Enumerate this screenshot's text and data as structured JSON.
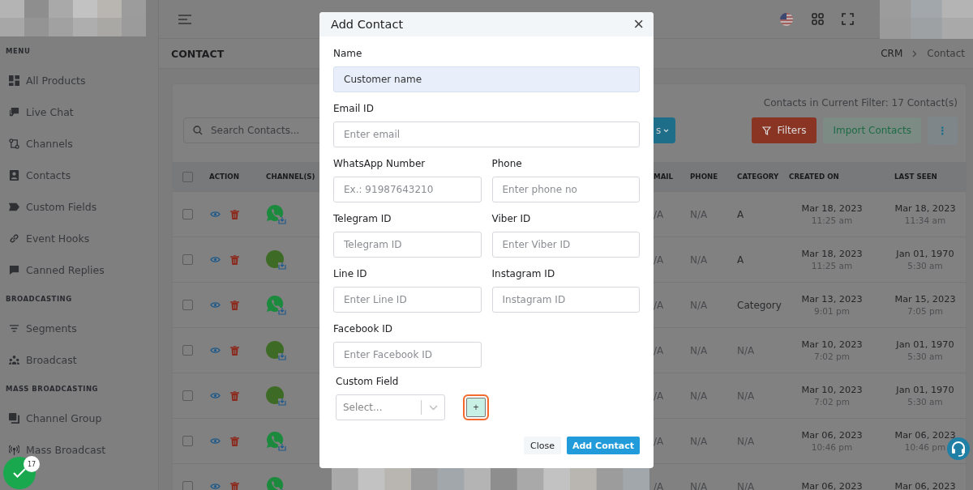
{
  "sidebar": {
    "sections": [
      {
        "title": "MENU",
        "items": [
          {
            "label": "All Products"
          },
          {
            "label": "Live Chat"
          },
          {
            "label": "Channels"
          },
          {
            "label": "Contacts"
          },
          {
            "label": "Custom Fields"
          },
          {
            "label": "Event Hooks"
          },
          {
            "label": "Canned Replies"
          }
        ]
      },
      {
        "title": "BROADCASTING",
        "items": [
          {
            "label": "Segments"
          },
          {
            "label": "Broadcast"
          }
        ]
      },
      {
        "title": "MASS BROADCASTING",
        "items": [
          {
            "label": "Channel Group"
          },
          {
            "label": "Mass Broadcast"
          }
        ]
      }
    ]
  },
  "page": {
    "title": "CONTACT",
    "breadcrumb": [
      "CRM",
      "Contact"
    ]
  },
  "toolbar": {
    "search_placeholder": "Search Contacts...",
    "partial_button": "s",
    "filter_summary": "Contacts in Current Filter: 17 Contact(s)",
    "filters_button": "Filters",
    "import_button": "Import Contacts",
    "more_button": "⋮"
  },
  "table": {
    "select_all_checked": false,
    "columns": [
      "ACTION",
      "CHANNEL(S)",
      "MAIL",
      "PHONE",
      "CATEGORY",
      "CREATED ON",
      "LAST SEEN"
    ],
    "rows": [
      {
        "checked": false,
        "kind": "whatsapp",
        "email": "/A",
        "phone": "N/A",
        "category": "A",
        "created_date": "Mar 18, 2023",
        "created_time": "11:25 am",
        "seen_date": "Mar 18, 2023",
        "seen_time": "11:34 am"
      },
      {
        "checked": false,
        "kind": "avatar",
        "email": "/A",
        "phone": "N/A",
        "category": "A",
        "created_date": "Mar 18, 2023",
        "created_time": "11:25 am",
        "seen_date": "Jan 01, 1970",
        "seen_time": "5:30 am"
      },
      {
        "checked": false,
        "kind": "whatsapp",
        "email": "/A",
        "phone": "N/A",
        "category": "Category",
        "created_date": "Mar 13, 2023",
        "created_time": "9:01 pm",
        "seen_date": "Mar 15, 2023",
        "seen_time": "7:05 pm"
      },
      {
        "checked": false,
        "kind": "avatar",
        "email": "/A",
        "phone": "N/A",
        "category": "N/A",
        "created_date": "Mar 10, 2023",
        "created_time": "7:02 pm",
        "seen_date": "Jan 01, 1970",
        "seen_time": "5:30 am"
      },
      {
        "checked": false,
        "kind": "avatar",
        "email": "/A",
        "phone": "N/A",
        "category": "N/A",
        "created_date": "Mar 10, 2023",
        "created_time": "7:02 pm",
        "seen_date": "Jan 01, 1970",
        "seen_time": "5:30 am"
      },
      {
        "checked": false,
        "kind": "whatsapp",
        "email": "/A",
        "phone": "N/A",
        "category": "N/A",
        "created_date": "Mar 06, 2023",
        "created_time": "10:46 pm",
        "seen_date": "Mar 06, 2023",
        "seen_time": "10:46 pm"
      },
      {
        "checked": false,
        "kind": "whatsapp",
        "email": "/A",
        "phone": "N/A",
        "category": "N/A",
        "created_date": "Mar 06, 2023",
        "seen_date": "Mar 06, 2023"
      }
    ]
  },
  "modal": {
    "title": "Add Contact",
    "close": "×",
    "field_rows": [
      [
        {
          "label": "Name",
          "value": "Customer name",
          "autofilled": true
        }
      ],
      [
        {
          "label": "Email ID",
          "placeholder": "Enter email"
        }
      ],
      [
        {
          "label": "WhatsApp Number",
          "placeholder": "Ex.: 91987643210"
        },
        {
          "label": "Phone",
          "placeholder": "Enter phone no"
        }
      ],
      [
        {
          "label": "Telegram ID",
          "placeholder": "Telegram ID"
        },
        {
          "label": "Viber ID",
          "placeholder": "Enter Viber ID"
        }
      ],
      [
        {
          "label": "Line ID",
          "placeholder": "Enter Line ID"
        },
        {
          "label": "Instagram ID",
          "placeholder": "Instagram ID"
        }
      ],
      [
        {
          "label": "Facebook ID",
          "placeholder": "Enter Facebook ID"
        }
      ]
    ],
    "custom_field": {
      "label": "Custom Field",
      "placeholder": "Select...",
      "add": "+",
      "add_focused": true
    },
    "buttons": [
      "Close",
      "Add Contact"
    ]
  },
  "notification_badge": "17"
}
